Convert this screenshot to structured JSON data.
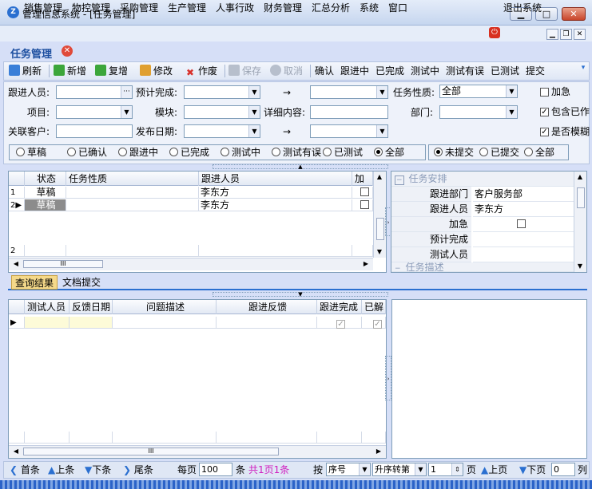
{
  "window": {
    "title": "管理信息系统 - [任务管理]",
    "logo": "Z"
  },
  "menu": [
    "销售管理",
    "物控管理",
    "采购管理",
    "生产管理",
    "人事行政",
    "财务管理",
    "汇总分析",
    "系统",
    "窗口"
  ],
  "exit_label": "退出系统",
  "doc_tab": {
    "title": "任务管理"
  },
  "toolbar": {
    "refresh": "刷新",
    "add": "新增",
    "copy": "复增",
    "edit": "修改",
    "void": "作废",
    "save": "保存",
    "cancel": "取消",
    "confirm": "确认",
    "following": "跟进中",
    "completed": "已完成",
    "testing": "测试中",
    "test_error": "测试有误",
    "tested": "已测试",
    "submit": "提交"
  },
  "filter": {
    "follower_label": "跟进人员:",
    "expected_label": "预计完成:",
    "arrow1": "→",
    "nature_label": "任务性质:",
    "nature_value": "全部",
    "urgent_label": "加急",
    "project_label": "项目:",
    "module_label": "模块:",
    "detail_label": "详细内容:",
    "dept_label": "部门:",
    "include_label": "包含已作",
    "customer_label": "关联客户:",
    "publish_label": "发布日期:",
    "arrow2": "→",
    "fuzzy_label": "是否模糊",
    "status_radios": [
      "草稿",
      "已确认",
      "跟进中",
      "已完成",
      "测试中",
      "测试有误",
      "已测试",
      "全部"
    ],
    "submit_radios": [
      "未提交",
      "已提交",
      "全部"
    ]
  },
  "grid1": {
    "headers": [
      "状态",
      "任务性质",
      "跟进人员",
      "加急"
    ],
    "rows": [
      {
        "no": "1",
        "status": "草稿",
        "nature": "",
        "follower": "李东方"
      },
      {
        "no": "2",
        "status": "草稿",
        "nature": "",
        "follower": "李东方"
      }
    ],
    "footer_no": "2"
  },
  "props": {
    "cat1": "任务安排",
    "rows": [
      {
        "k": "跟进部门",
        "v": "客户服务部"
      },
      {
        "k": "跟进人员",
        "v": "李东方"
      },
      {
        "k": "加急",
        "v": ""
      },
      {
        "k": "预计完成",
        "v": ""
      },
      {
        "k": "测试人员",
        "v": ""
      }
    ],
    "cat2": "任务描述"
  },
  "tabs2": [
    "查询结果",
    "文档提交"
  ],
  "grid2": {
    "headers": [
      "测试人员",
      "反馈日期",
      "问题描述",
      "跟进反馈",
      "跟进完成",
      "已解"
    ]
  },
  "status": {
    "first": "首条",
    "prev": "上条",
    "next": "下条",
    "last": "尾条",
    "per_page": "每页",
    "per_page_value": "100",
    "unit": "条",
    "summary": "共1页1条",
    "sort_by": "按",
    "sort_field": "序号",
    "sort_order": "升序转第",
    "page_value": "1",
    "page_unit": "页",
    "prev_page": "上页",
    "next_page": "下页",
    "col_value": "0",
    "col_unit": "列"
  }
}
